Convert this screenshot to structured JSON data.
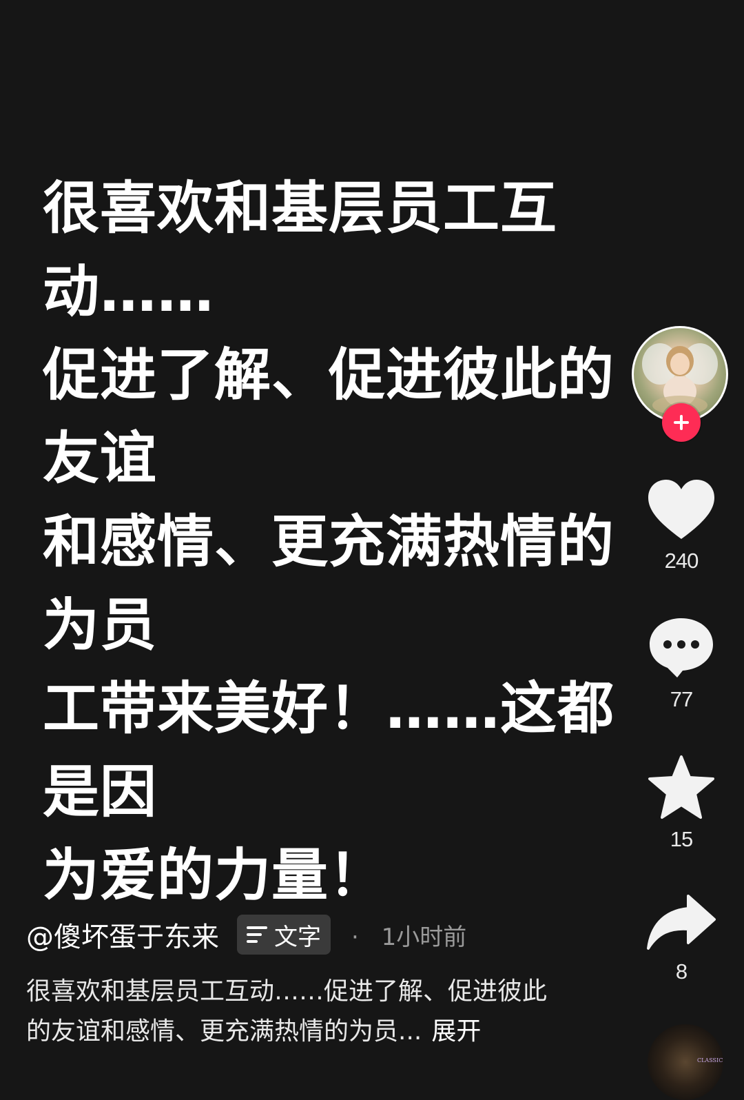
{
  "post": {
    "text": "很喜欢和基层员工互动……\n促进了解、促进彼此的友谊\n和感情、更充满热情的为员\n工带来美好！……这都是因\n为爱的力量！"
  },
  "rail": {
    "likes": "240",
    "comments": "77",
    "favorites": "15",
    "shares": "8"
  },
  "info": {
    "author": "@傻坏蛋于东来",
    "tag": "文字",
    "separator": "·",
    "time": "1小时前",
    "description": "很喜欢和基层员工互动……促进了解、促进彼此的友谊和感情、更充满热情的为员...",
    "expand": "展开"
  },
  "music": {
    "label": "CLASSICS"
  },
  "colors": {
    "background": "#161616",
    "follow": "#fe2c55",
    "tag_bg": "#3a3a3a",
    "icon": "#f2f2f2"
  }
}
